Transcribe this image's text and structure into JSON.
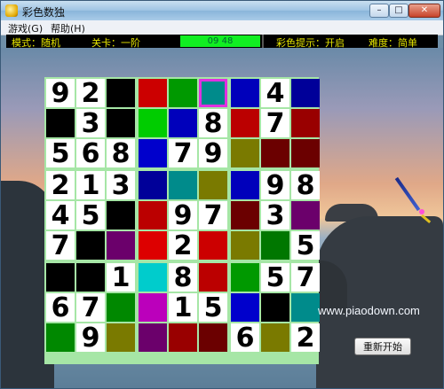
{
  "window": {
    "title": "彩色数独",
    "min": "–",
    "max": "□",
    "close": "✕"
  },
  "menu": {
    "items": [
      "游戏(G)",
      "帮助(H)"
    ]
  },
  "status": {
    "mode_label": "模式：随机",
    "level_label": "关卡：一阶",
    "timer": "09  48",
    "hint_label": "彩色提示：开启",
    "difficulty_label": "难度：简单"
  },
  "board": {
    "selected": [
      0,
      5
    ],
    "rows": [
      [
        "9",
        "2",
        "#000000",
        "#cc0000",
        "#009900",
        "#008b8b",
        "#0000bb",
        "4",
        "#000099"
      ],
      [
        "#000000",
        "3",
        "#000000",
        "#00cc00",
        "#0000bb",
        "8",
        "#bb0000",
        "7",
        "#990000"
      ],
      [
        "5",
        "6",
        "8",
        "#0000cc",
        "7",
        "9",
        "#7a7a00",
        "#6b0000",
        "#6b0000"
      ],
      [
        "2",
        "1",
        "3",
        "#000099",
        "#008b8b",
        "#7a7a00",
        "#0000bb",
        "9",
        "8"
      ],
      [
        "4",
        "5",
        "#000000",
        "#bb0000",
        "9",
        "7",
        "#6b0000",
        "3",
        "#6b006b"
      ],
      [
        "7",
        "#000000",
        "#6b006b",
        "#dd0000",
        "2",
        "#cc0000",
        "#7a7a00",
        "#007700",
        "5"
      ],
      [
        "#000000",
        "#000000",
        "1",
        "#00cccc",
        "8",
        "#bb0000",
        "#009900",
        "5",
        "7"
      ],
      [
        "6",
        "7",
        "#008800",
        "#bb00bb",
        "1",
        "5",
        "#0000cc",
        "#000000",
        "#008b8b"
      ],
      [
        "#008800",
        "9",
        "#7a7a00",
        "#6b006b",
        "#990000",
        "#6b0000",
        "6",
        "#7a7a00",
        "2"
      ]
    ]
  },
  "watermark": "www.piaodown.com",
  "restart_button": "重新开始"
}
